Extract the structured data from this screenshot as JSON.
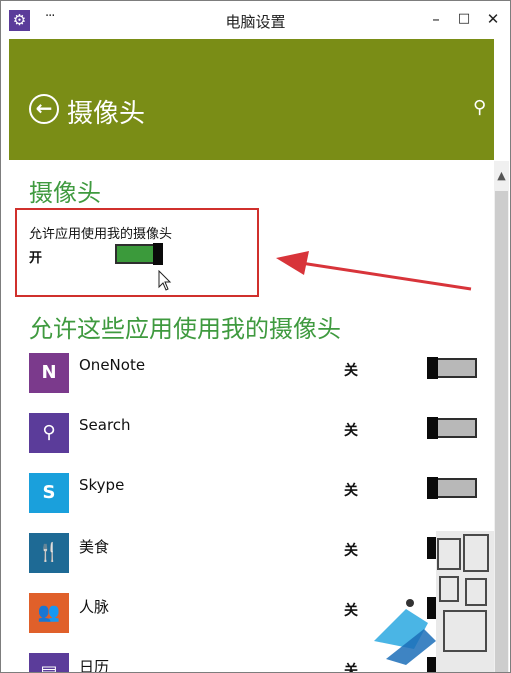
{
  "window": {
    "title": "电脑设置",
    "menu_dots": "···",
    "minimize": "–",
    "maximize": "□",
    "close": "✕"
  },
  "header": {
    "title": "摄像头"
  },
  "camera_section": {
    "title": "摄像头",
    "allow_label": "允许应用使用我的摄像头",
    "state": "开",
    "enabled": true
  },
  "apps_section": {
    "title": "允许这些应用使用我的摄像头",
    "apps": [
      {
        "name": "OneNote",
        "state": "关",
        "icon": "onenote-icon",
        "tile_color": "#7b3a8c",
        "glyph": "N"
      },
      {
        "name": "Search",
        "state": "关",
        "icon": "search-icon",
        "tile_color": "#5b3c9a",
        "glyph": "⚲"
      },
      {
        "name": "Skype",
        "state": "关",
        "icon": "skype-icon",
        "tile_color": "#1aa0dc",
        "glyph": "S"
      },
      {
        "name": "美食",
        "state": "关",
        "icon": "food-icon",
        "tile_color": "#1e6a95",
        "glyph": "🍴"
      },
      {
        "name": "人脉",
        "state": "关",
        "icon": "people-icon",
        "tile_color": "#e0602a",
        "glyph": "👥"
      },
      {
        "name": "日历",
        "state": "关",
        "icon": "calendar-icon",
        "tile_color": "#5b3c9a",
        "glyph": "▤"
      }
    ]
  },
  "colors": {
    "header_bg": "#7a8d16",
    "accent_green": "#3f9a3f",
    "highlight_red": "#d0302c"
  }
}
